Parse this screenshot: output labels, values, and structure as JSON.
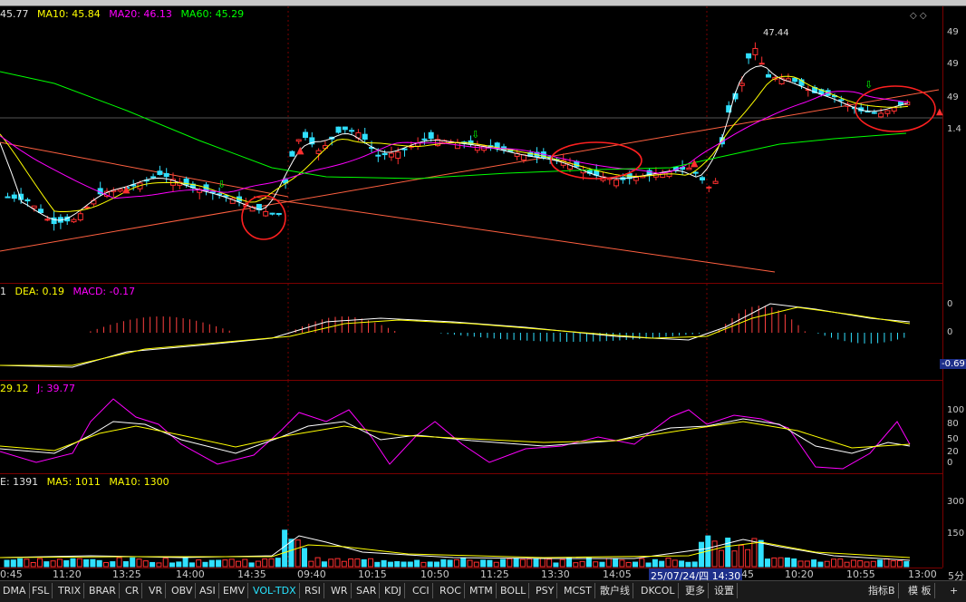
{
  "main": {
    "legend": [
      {
        "text": "45.77",
        "color": "#e0e0e0"
      },
      {
        "text": "MA10: 45.84",
        "color": "#ffff00"
      },
      {
        "text": "MA20: 46.13",
        "color": "#ff00ff"
      },
      {
        "text": "MA60: 45.29",
        "color": "#00ff00"
      }
    ],
    "high_label": "47.44",
    "axis": [
      "49",
      "49",
      "49",
      "1.4"
    ]
  },
  "macd": {
    "legend": [
      {
        "text": "1",
        "color": "#e0e0e0"
      },
      {
        "text": "DEA: 0.19",
        "color": "#ffff00"
      },
      {
        "text": "MACD: -0.17",
        "color": "#ff00ff"
      }
    ],
    "axis": [
      "0",
      "0",
      "-0.69"
    ]
  },
  "kdj": {
    "legend": [
      {
        "text": "29.12",
        "color": "#ffff00"
      },
      {
        "text": "J: 39.77",
        "color": "#ff00ff"
      }
    ],
    "axis": [
      "100",
      "80",
      "50",
      "20",
      "0"
    ]
  },
  "vol": {
    "legend": [
      {
        "text": "E: 1391",
        "color": "#e0e0e0"
      },
      {
        "text": "MA5: 1011",
        "color": "#ffff00"
      },
      {
        "text": "MA10: 1300",
        "color": "#ffff00"
      }
    ],
    "axis": [
      "300",
      "150"
    ]
  },
  "time_labels": [
    "0:45",
    "11:20",
    "13:25",
    "14:00",
    "14:35",
    "09:40",
    "10:15",
    "10:50",
    "11:25",
    "13:30",
    "14:05",
    "25/07/24/四 14:30",
    "45",
    "10:20",
    "10:55",
    "13:00"
  ],
  "period_label": "5分",
  "tabs": [
    "DMA",
    "FSL",
    "TRIX",
    "BRAR",
    "CR",
    "VR",
    "OBV",
    "ASI",
    "EMV",
    "VOL-TDX",
    "RSI",
    "WR",
    "SAR",
    "KDJ",
    "CCI",
    "ROC",
    "MTM",
    "BOLL",
    "PSY",
    "MCST",
    "散户线",
    "DKCOL",
    "更多",
    "设置"
  ],
  "active_tab": "VOL-TDX",
  "right_tabs": [
    "指标B",
    "模 板"
  ],
  "plus_label": "+"
}
